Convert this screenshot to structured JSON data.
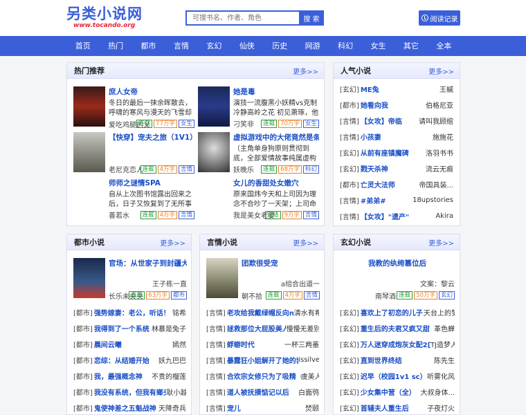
{
  "logo": {
    "title": "另类小说网",
    "sub": "www.tocando.org"
  },
  "search": {
    "placeholder": "可搜书名、作者、角色",
    "button": "搜 索"
  },
  "history": "阅读记录",
  "nav": [
    "首页",
    "热门",
    "都市",
    "言情",
    "玄幻",
    "仙侠",
    "历史",
    "网游",
    "科幻",
    "女生",
    "其它",
    "全本"
  ],
  "hot": {
    "title": "热门推荐",
    "more": "更多>>",
    "books": [
      {
        "title": "庶人女帝",
        "desc": "冬日的最后一抹余晖散去，呼啸的寒风与漫天的飞雪却未曾停",
        "author": "爱吃鸡腿的乂",
        "tags": [
          "连载",
          "77万字",
          "女生"
        ]
      },
      {
        "title": "她是毒",
        "desc": "演技一流腹黑小妖精vs克制冷静高岭之花 初见萧琢，他对她视若",
        "author": "刁笑非",
        "tags": [
          "连载",
          "70万字",
          "女生"
        ]
      },
      {
        "title": "【快穿】宠夫之旅（1V1）",
        "desc": "",
        "author": "老尼克恋人",
        "tags": [
          "连载",
          "4万字",
          "言情"
        ]
      },
      {
        "title": "虚拟游戏中的大佬竟然是条狗",
        "desc": "（主角单身狗原则贯彻到底，全部爱情故事纯属虚构be 穿插通讯录，",
        "author": "妖晚乐",
        "tags": [
          "连载",
          "68万字",
          "科幻"
        ]
      },
      {
        "title": "师师之谜情SPA",
        "desc": "自从上次图书馆露出回来之后，日子又恢复到了无所事事的状态，在家",
        "author": "善若水",
        "tags": [
          "连载",
          "4万字",
          "言情"
        ]
      },
      {
        "title": "女儿的香甜处女嫩穴",
        "desc": "原来国炜今天和上司因为理念不合吵了一天架；上司命他先下班",
        "author": "我是美女老婆",
        "tags": [
          "完结",
          "9万字",
          "言情"
        ]
      }
    ]
  },
  "popular": {
    "title": "人气小说",
    "more": "更多>>",
    "items": [
      {
        "cat": "[玄幻]",
        "name": "ME兔",
        "author": "王槭"
      },
      {
        "cat": "[都市]",
        "name": "她看向我",
        "author": "伯格尼亚"
      },
      {
        "cat": "[言情]",
        "name": "【女攻】帝临",
        "author": "请叫我顾绾"
      },
      {
        "cat": "[言情]",
        "name": "小孩妻",
        "author": "施施花"
      },
      {
        "cat": "[玄幻]",
        "name": "从前有座镇魔碑",
        "author": "洛羽书书"
      },
      {
        "cat": "[玄幻]",
        "name": "戮天杀神",
        "author": "流云无痕"
      },
      {
        "cat": "[都市]",
        "name": "亡灵大法师",
        "author": "帝国具装..."
      },
      {
        "cat": "[言情]",
        "name": "#弟弟#",
        "author": "18upstories"
      },
      {
        "cat": "[言情]",
        "name": "【女攻】\"遗产\"",
        "author": "Akira"
      }
    ]
  },
  "dushi": {
    "title": "都市小说",
    "more": "更多>>",
    "feature": {
      "title": "官场：从世家子到封疆大吏",
      "author": "王子栋一直",
      "author2": "长乐未央央",
      "tags": [
        "连载",
        "63万字",
        "都市"
      ]
    },
    "items": [
      {
        "cat": "[都市]",
        "name": "强势嫁妻：老公，听话！",
        "author": "铭希"
      },
      {
        "cat": "[都市]",
        "name": "我得到了一个系统",
        "author": "林慕是兔子"
      },
      {
        "cat": "[都市]",
        "name": "晨间云曦",
        "author": "嫣然"
      },
      {
        "cat": "[都市]",
        "name": "恋综：从结婚开始",
        "author": "妖九巴巴"
      },
      {
        "cat": "[都市]",
        "name": "我，最强概念神",
        "author": "不贵的榴莲"
      },
      {
        "cat": "[都市]",
        "name": "我没有系统，但我有鄉头",
        "author": "耿小越"
      },
      {
        "cat": "[都市]",
        "name": "鬼使神差之五魁战神",
        "author": "天降奇兵"
      }
    ]
  },
  "yanqing": {
    "title": "言情小说",
    "more": "更多>>",
    "feature": {
      "title": "团欺很受宠",
      "author": "a组合出道一",
      "author2": "朝不拾",
      "tags": [
        "连载",
        "4万字",
        "言情"
      ]
    },
    "items": [
      {
        "cat": "[言情]",
        "name": "老攻给我戴绿帽反向ntr",
        "author": "清水有希"
      },
      {
        "cat": "[言情]",
        "name": "拯救那位大屁股美人",
        "author": "慢慢无差别"
      },
      {
        "cat": "[言情]",
        "name": "蜉蝣时代",
        "author": "一杯三两墨"
      },
      {
        "cat": "[言情]",
        "name": "暴露狂小姐解开了她的套...",
        "author": "issilver"
      },
      {
        "cat": "[言情]",
        "name": "合欢宗女修只为了吸精（...",
        "author": "虞美人"
      },
      {
        "cat": "[言情]",
        "name": "道人被抚摸惦记以后",
        "author": "白面鸮"
      },
      {
        "cat": "[言情]",
        "name": "宠儿",
        "author": "焚颐"
      }
    ]
  },
  "xuanhuan": {
    "title": "玄幻小说",
    "more": "更多>>",
    "feature": {
      "title": "我教的纨绔篡位后",
      "author": "文案：黎云",
      "author2": "南琴酒",
      "tags": [
        "连载",
        "50万字",
        "玄幻"
      ]
    },
    "items": [
      {
        "cat": "[玄幻]",
        "name": "喜欢上了初恋的儿子...",
        "author": "天台上的梦"
      },
      {
        "cat": "[玄幻]",
        "name": "重生后的夫君又疯又甜",
        "author": "革色蝉"
      },
      {
        "cat": "[玄幻]",
        "name": "万人迷穿成炮灰女配2[...",
        "author": "TJ造梦人"
      },
      {
        "cat": "[玄幻]",
        "name": "直到世界终结",
        "author": "陈先生"
      },
      {
        "cat": "[玄幻]",
        "name": "迟早（校园1v1 sc）",
        "author": "听雾化风"
      },
      {
        "cat": "[玄幻]",
        "name": "少女集中营（全）",
        "author": "大叔身体..."
      },
      {
        "cat": "[玄幻]",
        "name": "首辅夫人重生后",
        "author": "子夜灯火"
      }
    ]
  },
  "colors": {
    "accent": "#3b5fd9",
    "link": "#1a4fc7"
  }
}
